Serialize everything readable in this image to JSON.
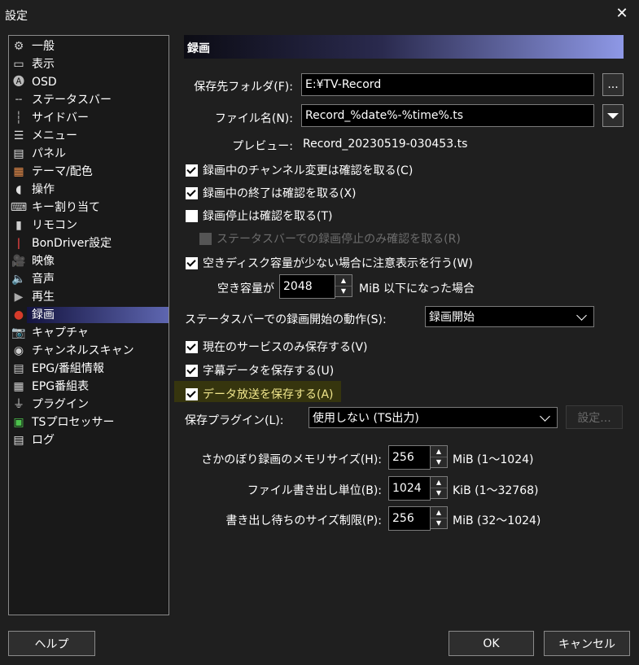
{
  "window": {
    "title": "設定",
    "close_glyph": "✕"
  },
  "sidebar": {
    "items": [
      {
        "label": "一般",
        "icon": "gear-icon",
        "glyph": "⚙",
        "color": "#cfcfcf"
      },
      {
        "label": "表示",
        "icon": "display-icon",
        "glyph": "▭",
        "color": "#e0e0e0"
      },
      {
        "label": "OSD",
        "icon": "osd-icon",
        "glyph": "🅐",
        "color": "#bbbbbb"
      },
      {
        "label": "ステータスバー",
        "icon": "statusbar-icon",
        "glyph": "╌",
        "color": "#bbbbbb"
      },
      {
        "label": "サイドバー",
        "icon": "sidebar-icon",
        "glyph": "┆",
        "color": "#bbbbbb"
      },
      {
        "label": "メニュー",
        "icon": "menu-icon",
        "glyph": "☰",
        "color": "#e0e0e0"
      },
      {
        "label": "パネル",
        "icon": "panel-icon",
        "glyph": "▤",
        "color": "#e0e0e0"
      },
      {
        "label": "テーマ/配色",
        "icon": "palette-icon",
        "glyph": "▦",
        "color": "#e58b4a"
      },
      {
        "label": "操作",
        "icon": "mouse-icon",
        "glyph": "◖",
        "color": "#e0e0e0"
      },
      {
        "label": "キー割り当て",
        "icon": "keyboard-icon",
        "glyph": "⌨",
        "color": "#cfcfcf"
      },
      {
        "label": "リモコン",
        "icon": "remote-icon",
        "glyph": "▮",
        "color": "#cfcfcf"
      },
      {
        "label": "BonDriver設定",
        "icon": "bondriver-icon",
        "glyph": "ǀ",
        "color": "#e04040"
      },
      {
        "label": "映像",
        "icon": "video-camera-icon",
        "glyph": "🎥",
        "color": "#cfcfcf"
      },
      {
        "label": "音声",
        "icon": "speaker-icon",
        "glyph": "🔈",
        "color": "#e0e0e0"
      },
      {
        "label": "再生",
        "icon": "play-icon",
        "glyph": "▶",
        "color": "#aaaaaa"
      },
      {
        "label": "録画",
        "icon": "record-icon",
        "glyph": "●",
        "color": "#d63b2a"
      },
      {
        "label": "キャプチャ",
        "icon": "camera-icon",
        "glyph": "📷",
        "color": "#e0e0e0"
      },
      {
        "label": "チャンネルスキャン",
        "icon": "scan-icon",
        "glyph": "◉",
        "color": "#cfcfcf"
      },
      {
        "label": "EPG/番組情報",
        "icon": "epg-icon",
        "glyph": "▤",
        "color": "#cfcfcf"
      },
      {
        "label": "EPG番組表",
        "icon": "epg-table-icon",
        "glyph": "▦",
        "color": "#cfcfcf"
      },
      {
        "label": "プラグイン",
        "icon": "plugin-icon",
        "glyph": "⏚",
        "color": "#cfcfcf"
      },
      {
        "label": "TSプロセッサー",
        "icon": "ts-processor-icon",
        "glyph": "▣",
        "color": "#4cc24c"
      },
      {
        "label": "ログ",
        "icon": "log-icon",
        "glyph": "▤",
        "color": "#e0e0e0"
      }
    ],
    "selected_index": 15
  },
  "panel": {
    "header": "録画",
    "folder_label": "保存先フォルダ(F):",
    "folder_value": "E:¥TV-Record",
    "browse_label": "...",
    "filename_label": "ファイル名(N):",
    "filename_value": "Record_%date%-%time%.ts",
    "preview_label": "プレビュー:",
    "preview_value": "Record_20230519-030453.ts",
    "checkboxes": [
      {
        "label": "録画中のチャンネル変更は確認を取る(C)",
        "checked": true
      },
      {
        "label": "録画中の終了は確認を取る(X)",
        "checked": true
      },
      {
        "label": "録画停止は確認を取る(T)",
        "checked": false
      },
      {
        "label": "ステータスバーでの録画停止のみ確認を取る(R)",
        "checked": false,
        "disabled": true
      },
      {
        "label": "空きディスク容量が少ない場合に注意表示を行う(W)",
        "checked": true
      }
    ],
    "free_space_label": "空き容量が",
    "free_space_value": "2048",
    "free_space_suffix": "MiB 以下になった場合",
    "statusbar_action_label": "ステータスバーでの録画開始の動作(S):",
    "statusbar_action_value": "録画開始",
    "checkboxes2": [
      {
        "label": "現在のサービスのみ保存する(V)",
        "checked": true
      },
      {
        "label": "字幕データを保存する(U)",
        "checked": true
      },
      {
        "label": "データ放送を保存する(A)",
        "checked": true,
        "highlighted": true
      }
    ],
    "plugin_label": "保存プラグイン(L):",
    "plugin_value": "使用しない (TS出力)",
    "plugin_settings_label": "設定...",
    "memory_label": "さかのぼり録画のメモリサイズ(H):",
    "memory_value": "256",
    "memory_suffix": "MiB (1～1024)",
    "unit_label": "ファイル書き出し単位(B):",
    "unit_value": "1024",
    "unit_suffix": "KiB (1～32768)",
    "pending_label": "書き出し待ちのサイズ制限(P):",
    "pending_value": "256",
    "pending_suffix": "MiB (32～1024)"
  },
  "footer": {
    "help_label": "ヘルプ",
    "ok_label": "OK",
    "cancel_label": "キャンセル"
  }
}
